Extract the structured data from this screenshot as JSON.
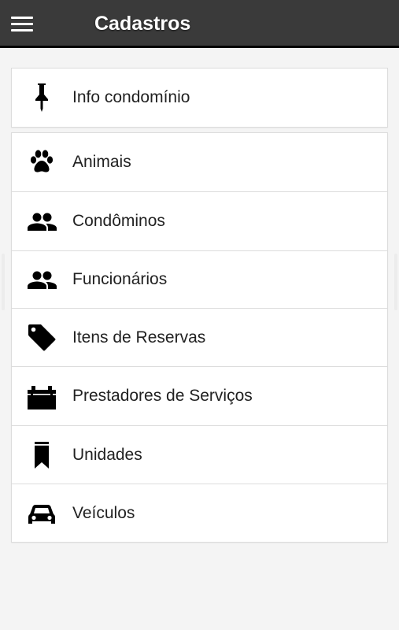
{
  "header": {
    "title": "Cadastros",
    "menu_icon": "hamburger-menu-icon"
  },
  "primary": {
    "label": "Info condomínio",
    "icon": "pushpin-icon"
  },
  "items": [
    {
      "label": "Animais",
      "icon": "paw-icon"
    },
    {
      "label": "Condôminos",
      "icon": "people-icon"
    },
    {
      "label": "Funcionários",
      "icon": "people-icon"
    },
    {
      "label": "Itens de Reservas",
      "icon": "tag-icon"
    },
    {
      "label": "Prestadores de Serviços",
      "icon": "toolbox-icon"
    },
    {
      "label": "Unidades",
      "icon": "bookmark-icon"
    },
    {
      "label": "Veículos",
      "icon": "car-icon"
    }
  ],
  "colors": {
    "appbar": "#3a3a3a",
    "background": "#f4f4f4",
    "card": "#ffffff",
    "text": "#212121"
  }
}
